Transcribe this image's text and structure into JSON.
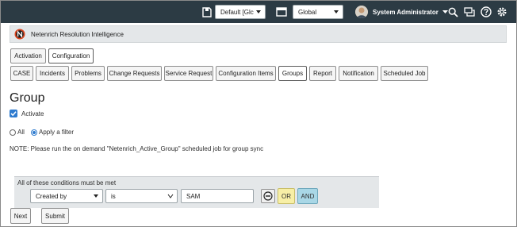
{
  "topbar": {
    "update_set_select": "Default [Glc",
    "scope_select": "Global",
    "user_name": "System Administrator"
  },
  "app": {
    "title": "Netenrich Resolution Intelligence"
  },
  "top_tabs": [
    {
      "label": "Activation"
    },
    {
      "label": "Configuration"
    }
  ],
  "sub_tabs": [
    {
      "label": "CASE"
    },
    {
      "label": "Incidents"
    },
    {
      "label": "Problems"
    },
    {
      "label": "Change Requests"
    },
    {
      "label": "Service Request"
    },
    {
      "label": "Configuration Items"
    },
    {
      "label": "Groups"
    },
    {
      "label": "Report"
    },
    {
      "label": "Notification"
    },
    {
      "label": "Scheduled Job"
    }
  ],
  "page": {
    "heading": "Group",
    "activate_label": "Activate",
    "radio_all": "All",
    "radio_filter": "Apply a filter",
    "note": "NOTE: Please run the on demand \"Netenrich_Active_Group\" scheduled job for group sync"
  },
  "condition": {
    "title": "All of these conditions must be met",
    "field": "Created by",
    "operator": "is",
    "value": "SAM",
    "or_label": "OR",
    "and_label": "AND"
  },
  "footer": {
    "next_label": "Next",
    "submit_label": "Submit"
  },
  "colors": {
    "topbar": "#2c3b44",
    "accent": "#2e7bcf",
    "or_button": "#f7efa6",
    "and_button": "#a9d7e6"
  }
}
